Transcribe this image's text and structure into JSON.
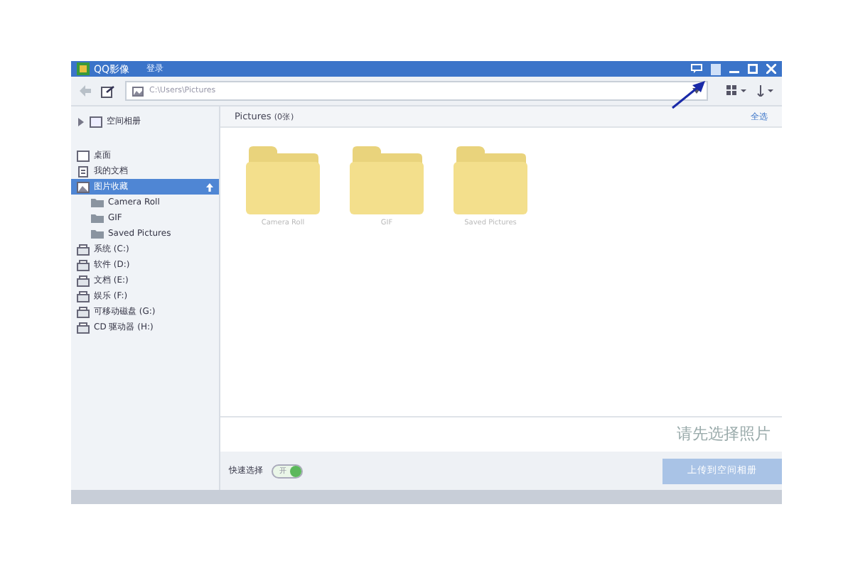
{
  "window": {
    "title": "QQ影像",
    "login": "登录"
  },
  "toolbar": {
    "address": "C:\\Users\\Pictures"
  },
  "sidebar": {
    "top_item": {
      "label": "空间相册",
      "expanded": false
    },
    "items": [
      {
        "label": "桌面",
        "kind": "desktop",
        "selected": false
      },
      {
        "label": "我的文档",
        "kind": "doc",
        "selected": false
      },
      {
        "label": "图片收藏",
        "kind": "pictures",
        "selected": true,
        "children": [
          {
            "label": "Camera Roll",
            "selected": false
          },
          {
            "label": "GIF",
            "selected": false
          },
          {
            "label": "Saved Pictures",
            "selected": false
          }
        ]
      },
      {
        "label": "系统 (C:)",
        "kind": "drive",
        "selected": false
      },
      {
        "label": "软件 (D:)",
        "kind": "drive",
        "selected": false
      },
      {
        "label": "文档 (E:)",
        "kind": "drive",
        "selected": false
      },
      {
        "label": "娱乐 (F:)",
        "kind": "drive",
        "selected": false
      },
      {
        "label": "可移动磁盘 (G:)",
        "kind": "drive",
        "selected": false
      },
      {
        "label": "CD 驱动器 (H:)",
        "kind": "drive",
        "selected": false
      }
    ]
  },
  "content": {
    "title": "Pictures",
    "count": "(0张)",
    "select_all": "全选",
    "folders": [
      {
        "label": "Camera Roll"
      },
      {
        "label": "GIF"
      },
      {
        "label": "Saved Pictures"
      }
    ]
  },
  "footer": {
    "hint": "请先选择照片",
    "quick_select": {
      "label": "快速选择",
      "on": true,
      "state_text": "开"
    },
    "upload_button": {
      "label": "上传到空间相册",
      "disabled": true
    }
  }
}
